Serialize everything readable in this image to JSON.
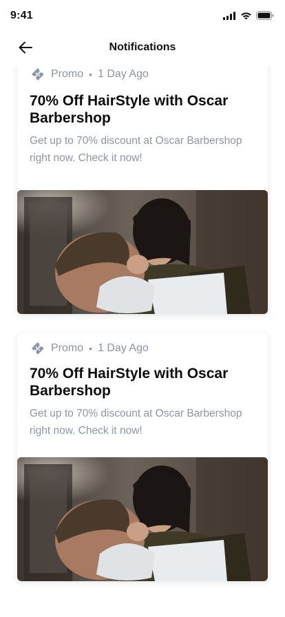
{
  "status_bar": {
    "time": "9:41",
    "icons": [
      "signal-icon",
      "wifi-icon",
      "battery-icon"
    ]
  },
  "header": {
    "back_icon": "arrow-left-icon",
    "title": "Notifications"
  },
  "notifications": [
    {
      "category": "Promo",
      "category_icon": "ticket-tag-icon",
      "separator": "•",
      "time_ago": "1 Day Ago",
      "title": "70% Off HairStyle with Oscar Barbershop",
      "description": "Get up to 70% discount at Oscar Barbershop right now. Check it now!",
      "image": "barber-styling-hair-photo"
    },
    {
      "category": "Promo",
      "category_icon": "ticket-tag-icon",
      "separator": "•",
      "time_ago": "1 Day Ago",
      "title": "70% Off HairStyle with Oscar Barbershop",
      "description": "Get up to 70% discount at Oscar Barbershop right now. Check it now!",
      "image": "barber-styling-hair-photo"
    }
  ],
  "colors": {
    "muted_text": "#8a93a6",
    "title_text": "#0d0d0d",
    "icon_gray": "#8d97ac"
  }
}
